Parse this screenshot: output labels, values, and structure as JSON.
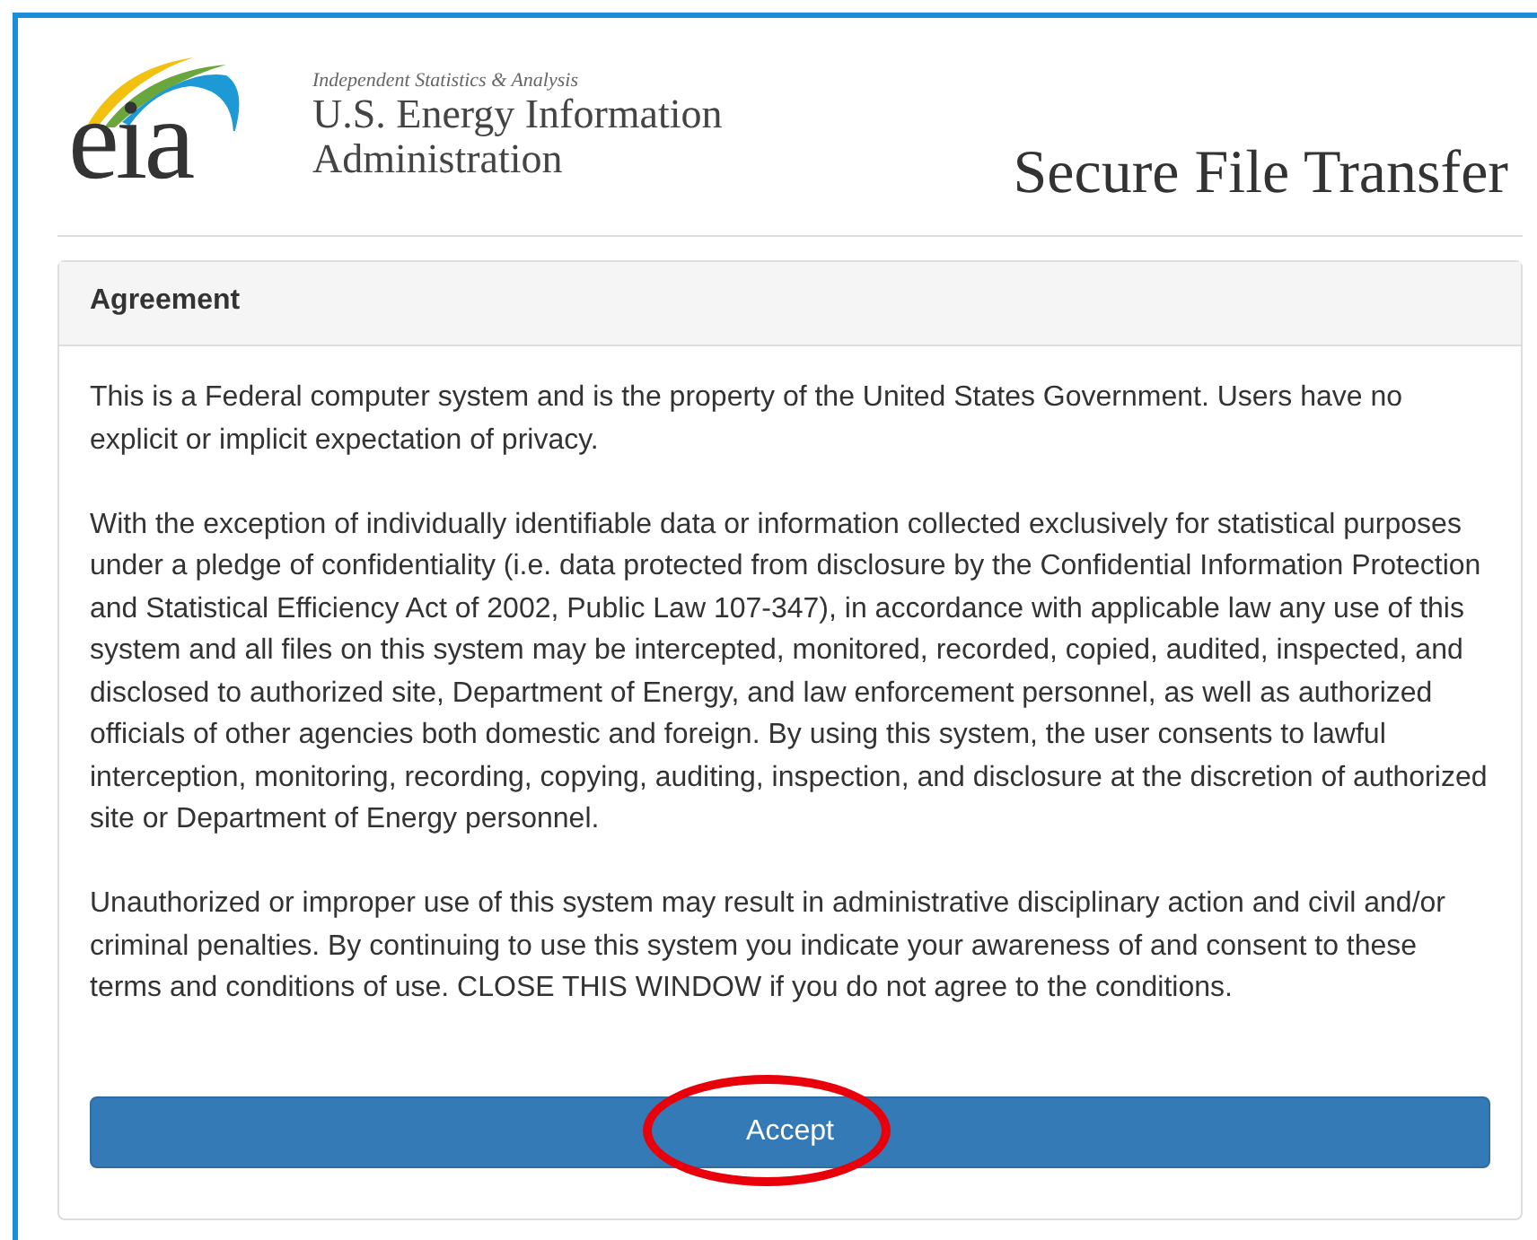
{
  "header": {
    "logo_text": "eia",
    "tagline": "Independent Statistics & Analysis",
    "agency_name": [
      "U.S. Energy Information",
      "Administration"
    ],
    "page_title": "Secure File Transfer"
  },
  "panel": {
    "title": "Agreement",
    "paragraphs": [
      "This is a Federal computer system and is the property of the United States Government. Users have no explicit or implicit expectation of privacy.",
      "With the exception of individually identifiable data or information collected exclusively for statistical purposes under a pledge of confidentiality (i.e. data protected from disclosure by the Confidential Information Protection and Statistical Efficiency Act of 2002, Public Law 107-347), in accordance with applicable law any use of this system and all files on this system may be intercepted, monitored, recorded, copied, audited, inspected, and disclosed to authorized site, Department of Energy, and law enforcement personnel, as well as authorized officials of other agencies both domestic and foreign. By using this system, the user consents to lawful interception, monitoring, recording, copying, auditing, inspection, and disclosure at the discretion of authorized site or Department of Energy personnel.",
      "Unauthorized or improper use of this system may result in administrative disciplinary action and civil and/or criminal penalties. By continuing to use this system you indicate your awareness of and consent to these terms and conditions of use. CLOSE THIS WINDOW if you do not agree to the conditions."
    ],
    "button": {
      "label": "Accept",
      "highlighted": true
    }
  }
}
